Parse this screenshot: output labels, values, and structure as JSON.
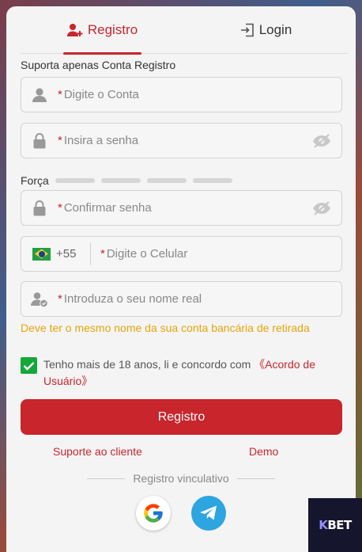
{
  "tabs": [
    {
      "label": "Registro",
      "icon": "user-plus-icon",
      "active": true
    },
    {
      "label": "Login",
      "icon": "door-enter-icon",
      "active": false
    }
  ],
  "subtitle": "Suporta apenas Conta Registro",
  "form": {
    "account": {
      "required": "*",
      "placeholder": "Digite o Conta",
      "icon": "user-icon"
    },
    "password": {
      "required": "*",
      "placeholder": "Insira a senha",
      "icon": "lock-icon"
    },
    "strength_label": "Força",
    "confirm": {
      "required": "*",
      "placeholder": "Confirmar senha",
      "icon": "lock-icon"
    },
    "phone": {
      "country_code": "+55",
      "flag": "brazil-flag-icon",
      "required": "*",
      "placeholder": "Digite o Celular"
    },
    "realname": {
      "required": "*",
      "placeholder": "Introduza o seu nome real",
      "icon": "user-check-icon"
    },
    "warning": "Deve ter o mesmo nome da sua conta bancária de retirada",
    "agree_text": "Tenho mais de 18 anos, li e concordo com ",
    "agree_link": "《Acordo de Usuário》",
    "agree_checked": true,
    "submit_label": "Registro"
  },
  "links": {
    "support": "Suporte ao cliente",
    "demo": "Demo"
  },
  "social": {
    "divider_label": "Registro vinculativo",
    "providers": [
      "google-icon",
      "telegram-icon"
    ]
  },
  "brand": {
    "k": "K",
    "rest": "BET"
  },
  "colors": {
    "accent": "#c8252c",
    "check": "#14a83a",
    "warning": "#e5a50a",
    "telegram": "#2ca5e0"
  }
}
